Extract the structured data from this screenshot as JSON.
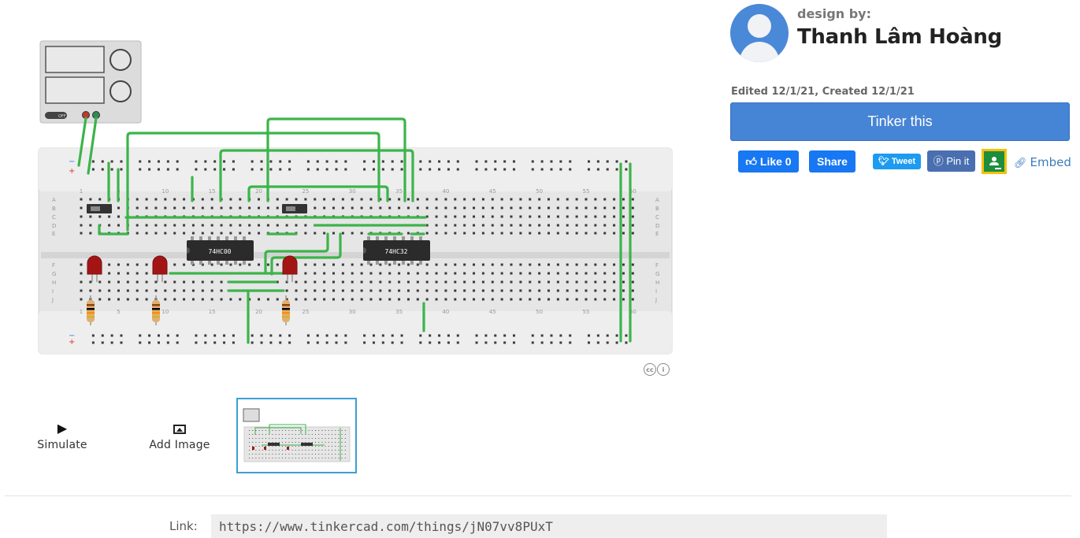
{
  "design": {
    "by_label": "design by:",
    "author": "Thanh Lâm Hoàng",
    "dates": "Edited 12/1/21, Created 12/1/21",
    "tinker_button": "Tinker this"
  },
  "social": {
    "like": "Like 0",
    "share": "Share",
    "tweet": "Tweet",
    "pin": "Pin it",
    "embed": "Embed"
  },
  "actions": {
    "simulate": "Simulate",
    "add_image": "Add Image"
  },
  "link": {
    "label": "Link:",
    "url": "https://www.tinkercad.com/things/jN07vv8PUxT"
  },
  "circuit": {
    "chips": [
      "74HC00",
      "74HC32"
    ],
    "column_numbers": [
      "1",
      "5",
      "10",
      "15",
      "20",
      "25",
      "30",
      "35",
      "40",
      "45",
      "50",
      "55",
      "60"
    ],
    "row_letters_top": [
      "A",
      "B",
      "C",
      "D",
      "E"
    ],
    "row_letters_bottom": [
      "F",
      "G",
      "H",
      "I",
      "J"
    ],
    "power_supply_off_label": "OFF"
  },
  "license": {
    "cc": "cc",
    "by": "i"
  },
  "colors": {
    "accent": "#4684d6",
    "wire": "#3cb44b",
    "led": "#a31515",
    "breadboard": "#e6e6e6",
    "facebook": "#1877f2",
    "twitter": "#1d9bf0",
    "pinterest": "#4a6fb0",
    "thumb_border": "#3da0d0"
  },
  "icons": {
    "simulate": "play-icon",
    "add_image": "image-icon",
    "like": "thumbs-up-icon",
    "tweet": "twitter-bird-icon",
    "pin": "pinterest-icon",
    "classroom": "google-classroom-icon",
    "embed": "link-chain-icon"
  }
}
